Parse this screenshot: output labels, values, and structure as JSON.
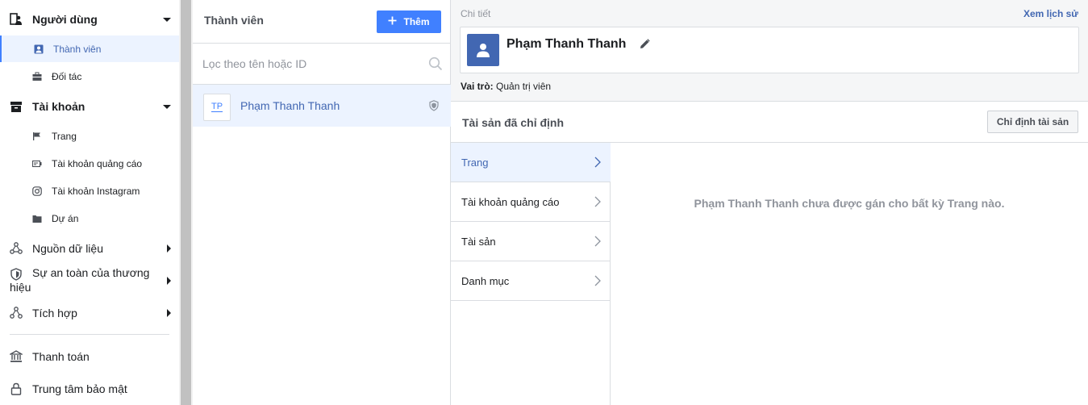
{
  "sidebar": {
    "users_group": {
      "label": "Người dùng",
      "icon": "people-icon"
    },
    "users_items": [
      {
        "label": "Thành viên",
        "icon": "person-badge-icon",
        "active": true
      },
      {
        "label": "Đối tác",
        "icon": "briefcase-icon",
        "active": false
      }
    ],
    "accounts_group": {
      "label": "Tài khoản",
      "icon": "archive-box-icon"
    },
    "accounts_items": [
      {
        "label": "Trang",
        "icon": "flag-icon"
      },
      {
        "label": "Tài khoản quảng cáo",
        "icon": "ad-account-icon"
      },
      {
        "label": "Tài khoản Instagram",
        "icon": "instagram-icon"
      },
      {
        "label": "Dự án",
        "icon": "folder-icon"
      }
    ],
    "data_sources": {
      "label": "Nguồn dữ liệu",
      "icon": "data-nodes-icon"
    },
    "brand_safety": {
      "label_line1": "Sự an toàn của thương",
      "label_line2": "hiệu",
      "icon": "shield-icon"
    },
    "integrations": {
      "label": "Tích hợp",
      "icon": "integration-nodes-icon"
    },
    "payments": {
      "label": "Thanh toán",
      "icon": "bank-icon"
    },
    "security_center": {
      "label": "Trung tâm bảo mật",
      "icon": "lock-icon"
    }
  },
  "members": {
    "title": "Thành viên",
    "add_label": "Thêm",
    "search_placeholder": "Lọc theo tên hoặc ID",
    "list": [
      {
        "initials": "TP",
        "name": "Phạm Thanh Thanh"
      }
    ]
  },
  "details": {
    "label": "Chi tiết",
    "history_link": "Xem lịch sử",
    "name": "Phạm Thanh Thanh",
    "role_label": "Vai trò:",
    "role_value": "Quản trị viên",
    "assets_title": "Tài sản đã chỉ định",
    "assign_button": "Chỉ định tài sản",
    "asset_tabs": [
      "Trang",
      "Tài khoản quảng cáo",
      "Tài sản",
      "Danh mục"
    ],
    "empty_message": "Phạm Thanh Thanh chưa được gán cho bất kỳ Trang nào."
  },
  "colors": {
    "accent": "#4080ff",
    "link": "#4267b2",
    "selected_bg": "#ecf3ff"
  }
}
